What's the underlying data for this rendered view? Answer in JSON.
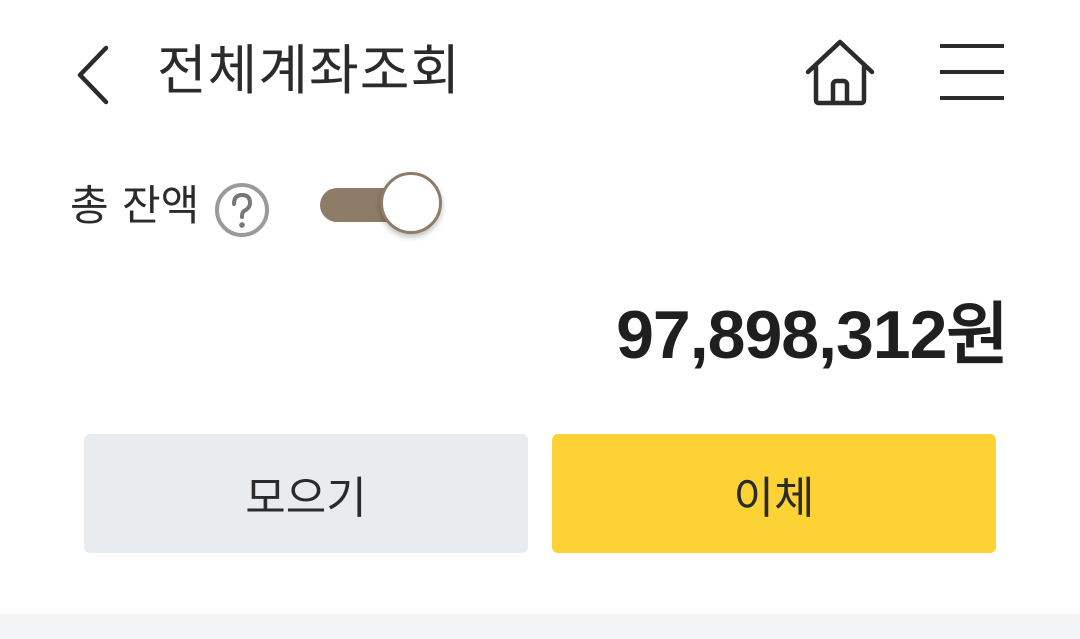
{
  "header": {
    "title": "전체계좌조회",
    "back_icon": "chevron-left-icon",
    "home_icon": "home-icon",
    "menu_icon": "hamburger-menu-icon"
  },
  "balance": {
    "label": "총 잔액",
    "help_icon": "question-circle-icon",
    "show_toggle_on": true,
    "amount": "97,898,312원"
  },
  "actions": {
    "collect_label": "모으기",
    "transfer_label": "이체"
  },
  "colors": {
    "toggle_accent": "#8d7c68",
    "transfer_button": "#fdd235",
    "collect_button": "#e9ecef"
  }
}
